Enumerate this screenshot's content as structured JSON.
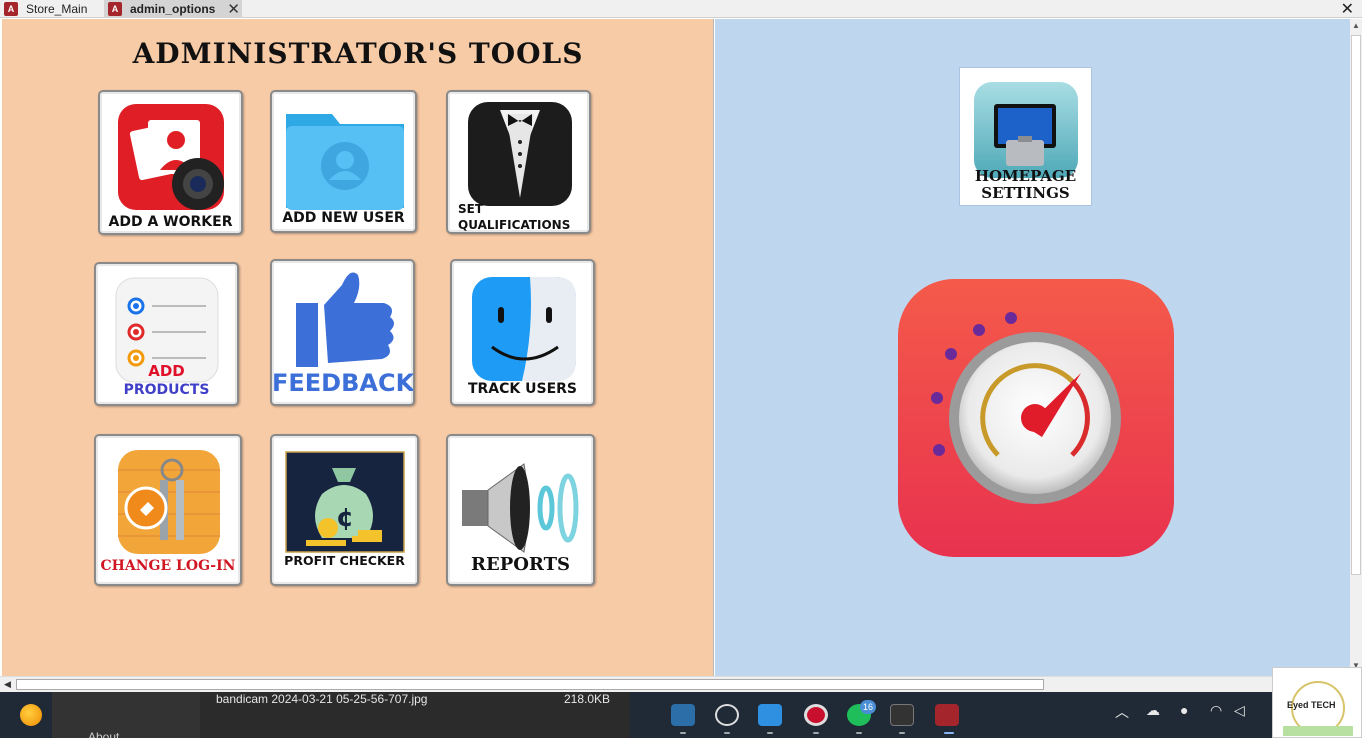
{
  "tabs": [
    {
      "label": "Store_Main"
    },
    {
      "label": "admin_options"
    }
  ],
  "window": {
    "close_glyph": "✕",
    "tab_close_glyph": "✕"
  },
  "admin": {
    "title": "ADMINISTRATOR'S TOOLS",
    "tiles": {
      "add_worker": "ADD A WORKER",
      "add_new_user": "ADD NEW USER",
      "set_qualifications_1": "SET",
      "set_qualifications_2": "QUALIFICATIONS",
      "add_products_1": "ADD",
      "add_products_2": "PRODUCTS",
      "feedback": "FEEDBACK",
      "track_users": "TRACK USERS",
      "change_login": "CHANGE LOG-IN",
      "profit_checker": "PROFIT CHECKER",
      "reports": "REPORTS"
    }
  },
  "homepage_settings": {
    "line1": "HOMEPAGE",
    "line2": "SETTINGS"
  },
  "taskbar": {
    "file_name": "bandicam 2024-03-21 05-25-56-707.jpg",
    "file_size": "218.0KB",
    "about": "About",
    "whatsapp_badge": "16",
    "brand_text": "Eyed TECH"
  },
  "icons": {
    "speedometer": "speedometer-icon",
    "access": "ms-access-icon"
  },
  "colors": {
    "left_panel": "#f8cba7",
    "right_panel": "#bfd7ee",
    "access_red": "#a4262c"
  }
}
